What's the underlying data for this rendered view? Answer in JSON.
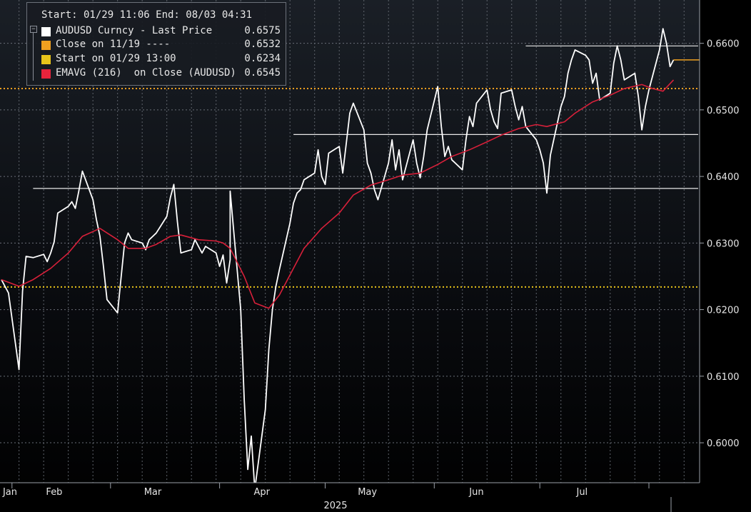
{
  "legend": {
    "header": "Start: 01/29 11:06 End: 08/03 04:31",
    "rows": [
      {
        "label": "AUDUSD Curncy - Last Price",
        "value": "0.6575",
        "color": "#ffffff"
      },
      {
        "label": "Close on 11/19 ----",
        "value": "0.6532",
        "color": "#f0a020"
      },
      {
        "label": "Start on 01/29 13:00",
        "value": "0.6234",
        "color": "#e8c41a"
      },
      {
        "label": "EMAVG (216)  on Close (AUDUSD)",
        "value": "0.6545",
        "color": "#e8243c"
      }
    ]
  },
  "chart_data": {
    "type": "line",
    "x_axis": {
      "month_labels": [
        "Jan",
        "Feb",
        "Mar",
        "Apr",
        "May",
        "Jun",
        "Jul"
      ],
      "year_label": "2025"
    },
    "y_axis": {
      "ticks": [
        "0.6600",
        "0.6500",
        "0.6400",
        "0.6300",
        "0.6200",
        "0.6100",
        "0.6000"
      ],
      "range": [
        0.594,
        0.6665
      ]
    },
    "grid": true,
    "series": [
      {
        "name": "AUDUSD Curncy - Last Price",
        "color": "#ffffff",
        "points": [
          [
            "01/29",
            0.6245
          ],
          [
            "01/31",
            0.6225
          ],
          [
            "02/03",
            0.611
          ],
          [
            "02/04",
            0.6228
          ],
          [
            "02/05",
            0.628
          ],
          [
            "02/07",
            0.6278
          ],
          [
            "02/10",
            0.6283
          ],
          [
            "02/11",
            0.6272
          ],
          [
            "02/12",
            0.6285
          ],
          [
            "02/13",
            0.6302
          ],
          [
            "02/14",
            0.6345
          ],
          [
            "02/17",
            0.6355
          ],
          [
            "02/18",
            0.6362
          ],
          [
            "02/19",
            0.6352
          ],
          [
            "02/20",
            0.6378
          ],
          [
            "02/21",
            0.6408
          ],
          [
            "02/24",
            0.6365
          ],
          [
            "02/25",
            0.6335
          ],
          [
            "02/26",
            0.631
          ],
          [
            "02/27",
            0.6265
          ],
          [
            "02/28",
            0.6215
          ],
          [
            "03/03",
            0.6195
          ],
          [
            "03/04",
            0.6248
          ],
          [
            "03/05",
            0.63
          ],
          [
            "03/06",
            0.6315
          ],
          [
            "03/07",
            0.6305
          ],
          [
            "03/10",
            0.63
          ],
          [
            "03/11",
            0.629
          ],
          [
            "03/12",
            0.6305
          ],
          [
            "03/13",
            0.631
          ],
          [
            "03/14",
            0.6315
          ],
          [
            "03/17",
            0.634
          ],
          [
            "03/18",
            0.6368
          ],
          [
            "03/19",
            0.6388
          ],
          [
            "03/20",
            0.6332
          ],
          [
            "03/21",
            0.6285
          ],
          [
            "03/24",
            0.629
          ],
          [
            "03/25",
            0.6305
          ],
          [
            "03/26",
            0.6295
          ],
          [
            "03/27",
            0.6285
          ],
          [
            "03/28",
            0.6295
          ],
          [
            "03/31",
            0.6285
          ],
          [
            "04/01",
            0.6265
          ],
          [
            "04/02",
            0.6282
          ],
          [
            "04/03",
            0.624
          ],
          [
            "04/04",
            0.6275
          ],
          [
            "04/04",
            0.6378
          ],
          [
            "04/07",
            0.62
          ],
          [
            "04/08",
            0.6065
          ],
          [
            "04/09",
            0.596
          ],
          [
            "04/10",
            0.601
          ],
          [
            "04/11",
            0.593
          ],
          [
            "04/14",
            0.605
          ],
          [
            "04/15",
            0.614
          ],
          [
            "04/16",
            0.62
          ],
          [
            "04/17",
            0.6235
          ],
          [
            "04/18",
            0.626
          ],
          [
            "04/21",
            0.633
          ],
          [
            "04/22",
            0.636
          ],
          [
            "04/23",
            0.6375
          ],
          [
            "04/24",
            0.638
          ],
          [
            "04/25",
            0.6395
          ],
          [
            "04/28",
            0.6405
          ],
          [
            "04/29",
            0.644
          ],
          [
            "04/30",
            0.64
          ],
          [
            "05/01",
            0.6388
          ],
          [
            "05/02",
            0.6435
          ],
          [
            "05/05",
            0.6445
          ],
          [
            "05/06",
            0.6405
          ],
          [
            "05/07",
            0.645
          ],
          [
            "05/08",
            0.6495
          ],
          [
            "05/09",
            0.651
          ],
          [
            "05/12",
            0.647
          ],
          [
            "05/13",
            0.642
          ],
          [
            "05/14",
            0.6405
          ],
          [
            "05/15",
            0.638
          ],
          [
            "05/16",
            0.6365
          ],
          [
            "05/19",
            0.642
          ],
          [
            "05/20",
            0.6455
          ],
          [
            "05/21",
            0.641
          ],
          [
            "05/22",
            0.644
          ],
          [
            "05/23",
            0.6395
          ],
          [
            "05/26",
            0.6455
          ],
          [
            "05/27",
            0.642
          ],
          [
            "05/28",
            0.6398
          ],
          [
            "05/29",
            0.643
          ],
          [
            "05/30",
            0.647
          ],
          [
            "06/02",
            0.6535
          ],
          [
            "06/03",
            0.6475
          ],
          [
            "06/04",
            0.643
          ],
          [
            "06/05",
            0.6445
          ],
          [
            "06/06",
            0.6425
          ],
          [
            "06/09",
            0.641
          ],
          [
            "06/10",
            0.6455
          ],
          [
            "06/11",
            0.649
          ],
          [
            "06/12",
            0.6475
          ],
          [
            "06/13",
            0.651
          ],
          [
            "06/16",
            0.653
          ],
          [
            "06/17",
            0.65
          ],
          [
            "06/18",
            0.6482
          ],
          [
            "06/19",
            0.6472
          ],
          [
            "06/20",
            0.6525
          ],
          [
            "06/23",
            0.653
          ],
          [
            "06/24",
            0.6505
          ],
          [
            "06/25",
            0.6485
          ],
          [
            "06/26",
            0.6505
          ],
          [
            "06/27",
            0.6475
          ],
          [
            "06/30",
            0.6455
          ],
          [
            "07/01",
            0.644
          ],
          [
            "07/02",
            0.642
          ],
          [
            "07/03",
            0.6375
          ],
          [
            "07/04",
            0.6432
          ],
          [
            "07/07",
            0.6505
          ],
          [
            "07/08",
            0.652
          ],
          [
            "07/09",
            0.6555
          ],
          [
            "07/10",
            0.6575
          ],
          [
            "07/11",
            0.659
          ],
          [
            "07/14",
            0.6582
          ],
          [
            "07/15",
            0.6575
          ],
          [
            "07/16",
            0.654
          ],
          [
            "07/17",
            0.6555
          ],
          [
            "07/18",
            0.6515
          ],
          [
            "07/21",
            0.6525
          ],
          [
            "07/22",
            0.657
          ],
          [
            "07/23",
            0.6596
          ],
          [
            "07/24",
            0.6575
          ],
          [
            "07/25",
            0.6545
          ],
          [
            "07/28",
            0.6555
          ],
          [
            "07/29",
            0.652
          ],
          [
            "07/30",
            0.647
          ],
          [
            "07/31",
            0.6505
          ],
          [
            "08/01",
            0.653
          ],
          [
            "08/04",
            0.659
          ],
          [
            "08/05",
            0.6622
          ],
          [
            "08/06",
            0.66
          ],
          [
            "08/07",
            0.6565
          ],
          [
            "08/08",
            0.6575
          ]
        ]
      },
      {
        "name": "EMAVG (216)  on Close (AUDUSD)",
        "color": "#d8203a",
        "points": [
          [
            "01/29",
            0.6245
          ],
          [
            "02/03",
            0.6235
          ],
          [
            "02/07",
            0.6245
          ],
          [
            "02/12",
            0.6262
          ],
          [
            "02/17",
            0.6285
          ],
          [
            "02/21",
            0.631
          ],
          [
            "02/26",
            0.6322
          ],
          [
            "03/03",
            0.6305
          ],
          [
            "03/06",
            0.6292
          ],
          [
            "03/11",
            0.6292
          ],
          [
            "03/14",
            0.6298
          ],
          [
            "03/18",
            0.631
          ],
          [
            "03/21",
            0.6312
          ],
          [
            "03/26",
            0.6305
          ],
          [
            "03/31",
            0.6303
          ],
          [
            "04/02",
            0.63
          ],
          [
            "04/04",
            0.6292
          ],
          [
            "04/08",
            0.625
          ],
          [
            "04/11",
            0.621
          ],
          [
            "04/15",
            0.6202
          ],
          [
            "04/18",
            0.6222
          ],
          [
            "04/22",
            0.6262
          ],
          [
            "04/25",
            0.6292
          ],
          [
            "04/30",
            0.6322
          ],
          [
            "05/05",
            0.6345
          ],
          [
            "05/09",
            0.6372
          ],
          [
            "05/14",
            0.6387
          ],
          [
            "05/19",
            0.6395
          ],
          [
            "05/23",
            0.6402
          ],
          [
            "05/28",
            0.6405
          ],
          [
            "06/02",
            0.6418
          ],
          [
            "06/06",
            0.643
          ],
          [
            "06/11",
            0.644
          ],
          [
            "06/16",
            0.6452
          ],
          [
            "06/20",
            0.6462
          ],
          [
            "06/25",
            0.6472
          ],
          [
            "06/30",
            0.6478
          ],
          [
            "07/03",
            0.6475
          ],
          [
            "07/08",
            0.6482
          ],
          [
            "07/11",
            0.6495
          ],
          [
            "07/16",
            0.6512
          ],
          [
            "07/21",
            0.6522
          ],
          [
            "07/25",
            0.6532
          ],
          [
            "07/30",
            0.6538
          ],
          [
            "08/02",
            0.6532
          ],
          [
            "08/05",
            0.6528
          ],
          [
            "08/08",
            0.6545
          ]
        ]
      }
    ],
    "reference_lines": [
      {
        "name": "Close on 11/19 ----",
        "value": 0.6532,
        "color": "#f0a020",
        "style": "dotted"
      },
      {
        "name": "Start on 01/29 13:00",
        "value": 0.6234,
        "color": "#e8c41a",
        "style": "dotted"
      }
    ],
    "levels": [
      {
        "value": 0.6596,
        "from": "06/27",
        "to": "08/15"
      },
      {
        "value": 0.6463,
        "from": "04/22",
        "to": "08/15"
      },
      {
        "value": 0.6382,
        "from": "02/07",
        "to": "08/15"
      }
    ],
    "last_value_marker": {
      "value": 0.6575,
      "color": "#f0a020"
    }
  }
}
